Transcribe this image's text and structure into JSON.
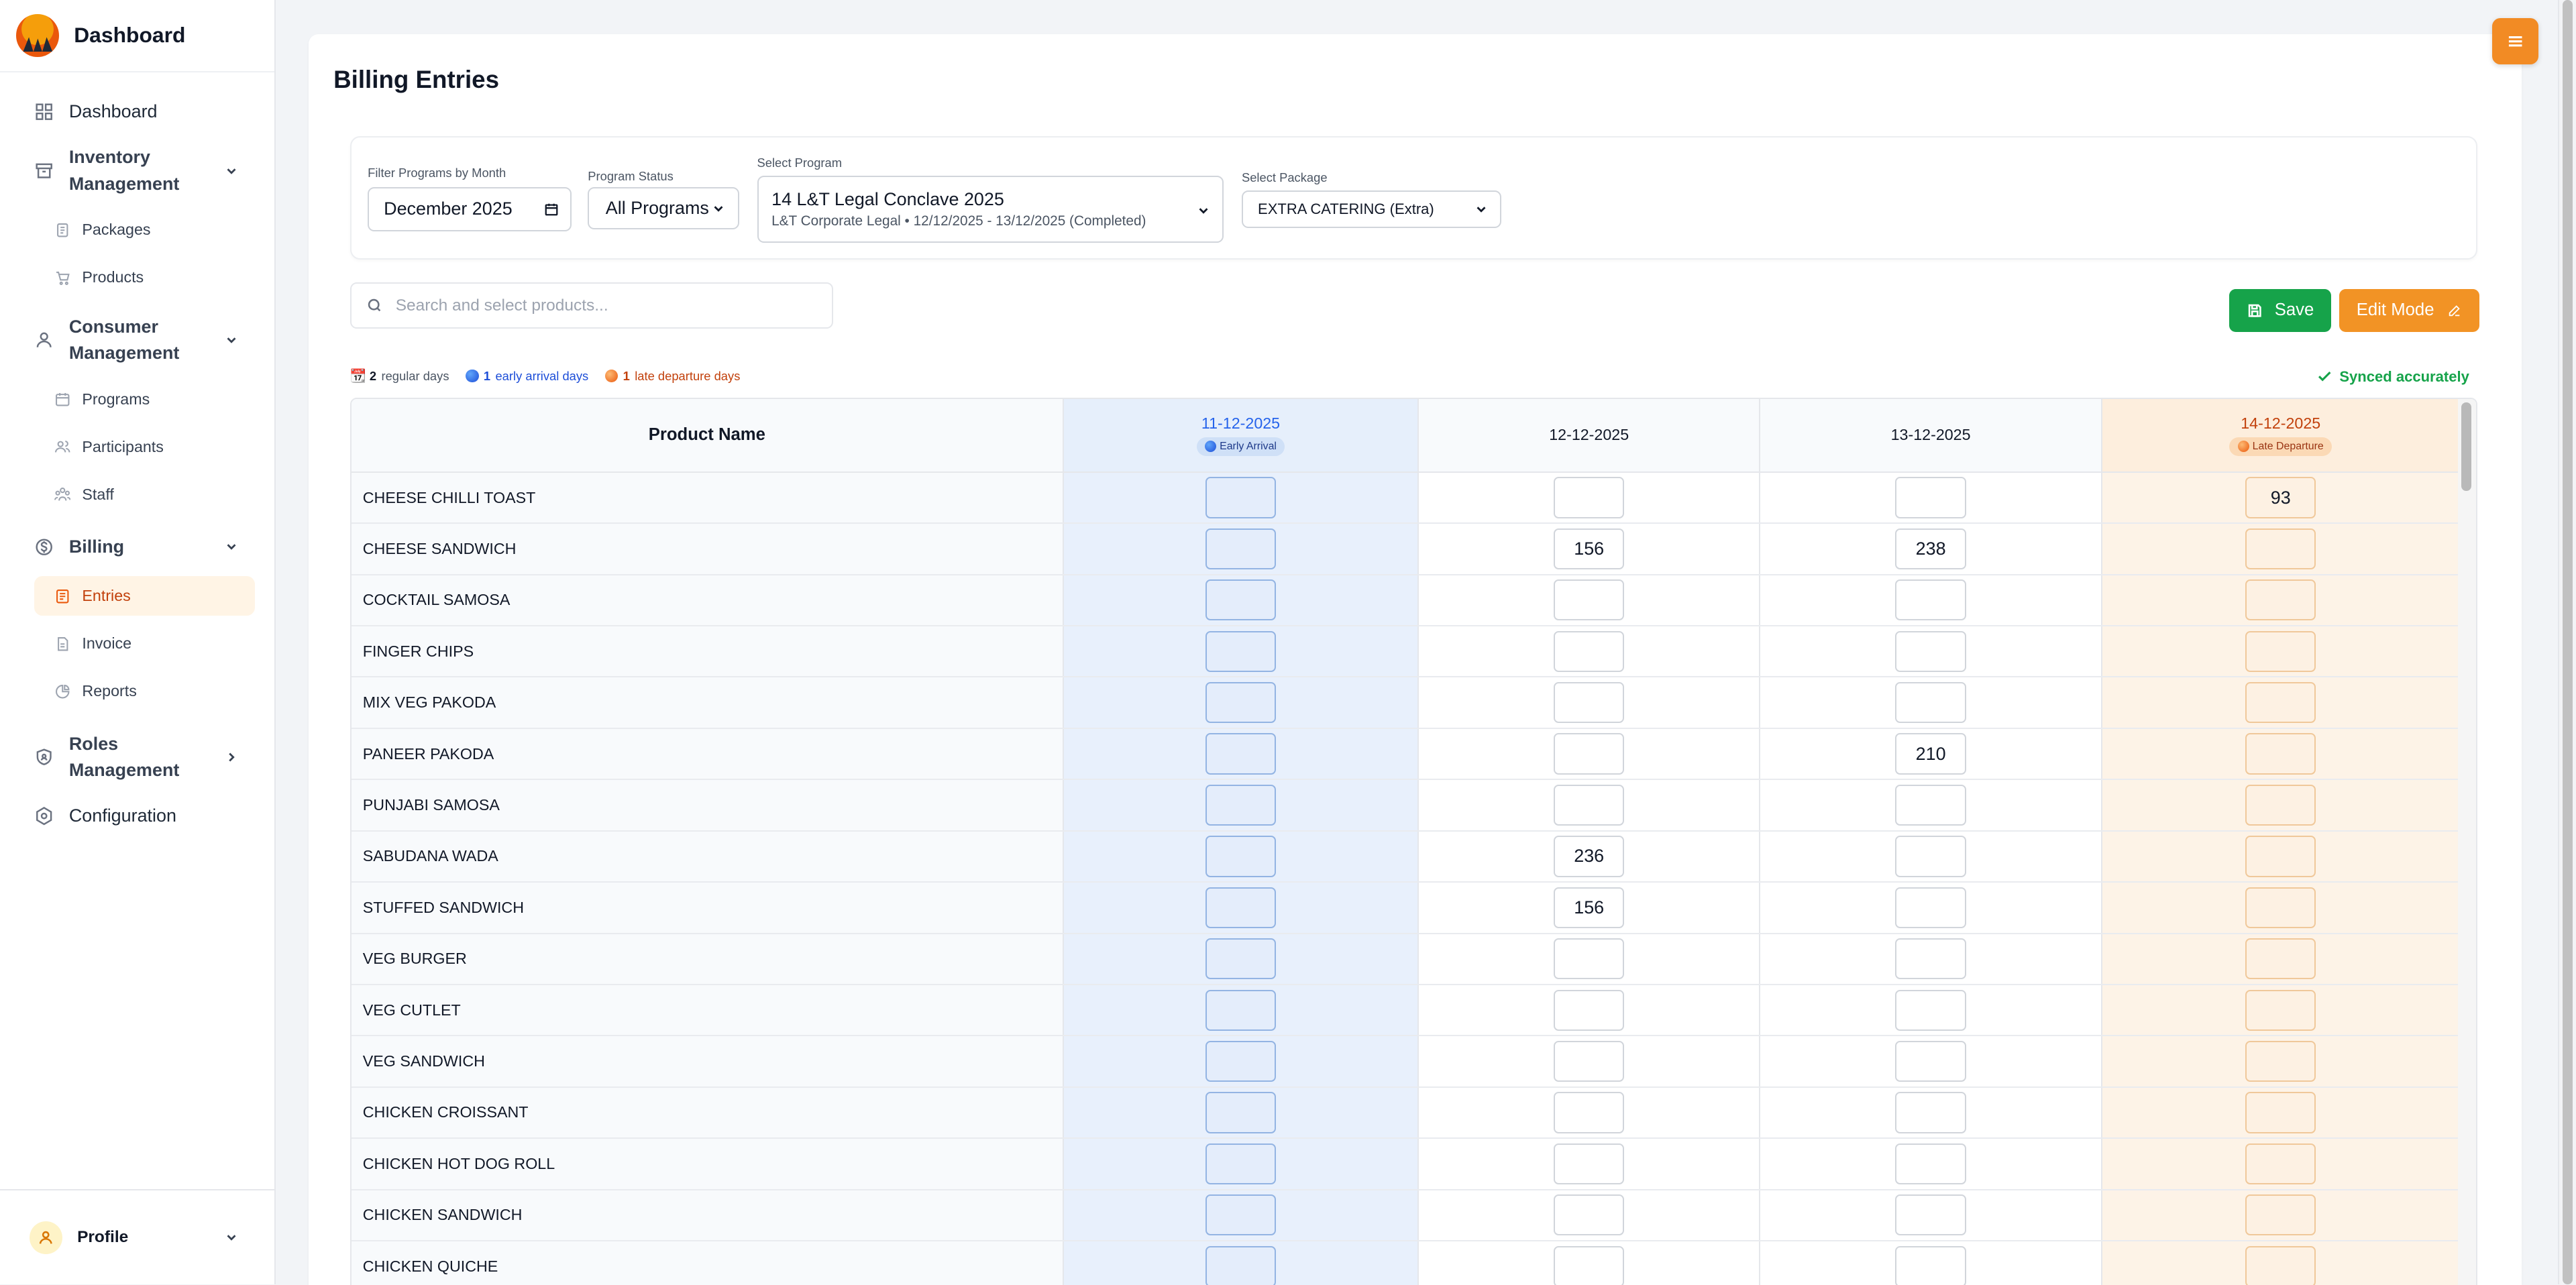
{
  "app": {
    "title": "Dashboard"
  },
  "sidebar": {
    "dashboard": "Dashboard",
    "inventory": {
      "label": "Inventory Management",
      "items": [
        "Packages",
        "Products"
      ]
    },
    "consumer": {
      "label": "Consumer Management",
      "items": [
        "Programs",
        "Participants",
        "Staff"
      ]
    },
    "billing": {
      "label": "Billing",
      "items": [
        "Entries",
        "Invoice",
        "Reports"
      ],
      "active": "Entries"
    },
    "roles": "Roles Management",
    "configuration": "Configuration",
    "profile": "Profile"
  },
  "page": {
    "title": "Billing Entries"
  },
  "filters": {
    "month": {
      "label": "Filter Programs by Month",
      "value": "December 2025"
    },
    "status": {
      "label": "Program Status",
      "value": "All Programs"
    },
    "program": {
      "label": "Select Program",
      "value": "14 L&T Legal Conclave 2025",
      "sub": "L&T Corporate Legal • 12/12/2025 - 13/12/2025 (Completed)"
    },
    "package": {
      "label": "Select Package",
      "value": "EXTRA CATERING (Extra)"
    }
  },
  "search": {
    "placeholder": "Search and select products..."
  },
  "actions": {
    "save": "Save",
    "edit": "Edit Mode"
  },
  "legend": {
    "regular_count": "2",
    "regular_label": "regular days",
    "early_count": "1",
    "early_label": "early arrival days",
    "late_count": "1",
    "late_label": "late departure days"
  },
  "status": {
    "synced": "Synced accurately"
  },
  "table": {
    "name_header": "Product Name",
    "dates": [
      {
        "date": "11-12-2025",
        "badge": "Early Arrival",
        "kind": "early"
      },
      {
        "date": "12-12-2025",
        "badge": "",
        "kind": "regular"
      },
      {
        "date": "13-12-2025",
        "badge": "",
        "kind": "regular"
      },
      {
        "date": "14-12-2025",
        "badge": "Late Departure",
        "kind": "late"
      }
    ],
    "rows": [
      {
        "name": "CHEESE CHILLI TOAST",
        "values": [
          "",
          "",
          "",
          "93"
        ]
      },
      {
        "name": "CHEESE SANDWICH",
        "values": [
          "",
          "156",
          "238",
          ""
        ]
      },
      {
        "name": "COCKTAIL SAMOSA",
        "values": [
          "",
          "",
          "",
          ""
        ]
      },
      {
        "name": "FINGER CHIPS",
        "values": [
          "",
          "",
          "",
          ""
        ]
      },
      {
        "name": "MIX VEG PAKODA",
        "values": [
          "",
          "",
          "",
          ""
        ]
      },
      {
        "name": "PANEER PAKODA",
        "values": [
          "",
          "",
          "210",
          ""
        ]
      },
      {
        "name": "PUNJABI SAMOSA",
        "values": [
          "",
          "",
          "",
          ""
        ]
      },
      {
        "name": "SABUDANA WADA",
        "values": [
          "",
          "236",
          "",
          ""
        ]
      },
      {
        "name": "STUFFED SANDWICH",
        "values": [
          "",
          "156",
          "",
          ""
        ]
      },
      {
        "name": "VEG BURGER",
        "values": [
          "",
          "",
          "",
          ""
        ]
      },
      {
        "name": "VEG CUTLET",
        "values": [
          "",
          "",
          "",
          ""
        ]
      },
      {
        "name": "VEG SANDWICH",
        "values": [
          "",
          "",
          "",
          ""
        ]
      },
      {
        "name": "CHICKEN CROISSANT",
        "values": [
          "",
          "",
          "",
          ""
        ]
      },
      {
        "name": "CHICKEN HOT DOG ROLL",
        "values": [
          "",
          "",
          "",
          ""
        ]
      },
      {
        "name": "CHICKEN SANDWICH",
        "values": [
          "",
          "",
          "",
          ""
        ]
      },
      {
        "name": "CHICKEN QUICHE",
        "values": [
          "",
          "",
          "",
          ""
        ]
      }
    ]
  },
  "colors": {
    "accent": "#f28b24",
    "save": "#16a34a",
    "early": "#2563eb",
    "late": "#c2410c"
  }
}
